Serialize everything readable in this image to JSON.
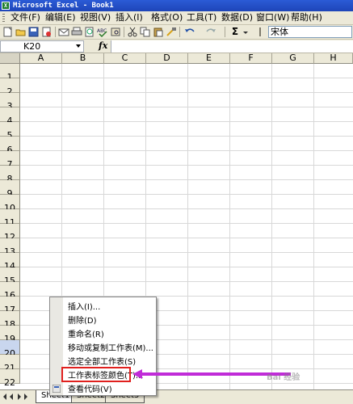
{
  "window": {
    "title": "Microsoft Excel - Book1",
    "app_icon": "excel-icon"
  },
  "menubar": {
    "items": [
      {
        "label": "文件(F)"
      },
      {
        "label": "编辑(E)"
      },
      {
        "label": "视图(V)"
      },
      {
        "label": "插入(I)"
      },
      {
        "label": "格式(O)"
      },
      {
        "label": "工具(T)"
      },
      {
        "label": "数据(D)"
      },
      {
        "label": "窗口(W)"
      },
      {
        "label": "帮助(H)"
      }
    ]
  },
  "toolbar": {
    "font_name": "宋体",
    "sum_symbol": "Σ",
    "icons": [
      "new-icon",
      "open-icon",
      "save-icon",
      "permission-icon",
      "email-icon",
      "print-icon",
      "print-preview-icon",
      "spelling-icon",
      "research-icon",
      "cut-icon",
      "copy-icon",
      "paste-icon",
      "format-painter-icon",
      "undo-icon",
      "redo-icon",
      "autosum-icon"
    ]
  },
  "formula_bar": {
    "name_box": "K20",
    "fx_label": "fx",
    "formula": ""
  },
  "grid": {
    "columns": [
      "A",
      "B",
      "C",
      "D",
      "E",
      "F",
      "G",
      "H"
    ],
    "rows": [
      "1",
      "2",
      "3",
      "4",
      "5",
      "6",
      "7",
      "8",
      "9",
      "10",
      "11",
      "12",
      "13",
      "14",
      "15",
      "16",
      "17",
      "18",
      "19",
      "20",
      "21",
      "22"
    ],
    "selected_row": "20"
  },
  "sheet_tabs": {
    "tabs": [
      {
        "label": "Sheet1"
      },
      {
        "label": "Sheet2"
      },
      {
        "label": "Sheet3"
      }
    ],
    "active_index": 0
  },
  "context_menu": {
    "items": [
      {
        "label": "插入(I)..."
      },
      {
        "label": "删除(D)"
      },
      {
        "label": "重命名(R)"
      },
      {
        "label": "移动或复制工作表(M)..."
      },
      {
        "label": "选定全部工作表(S)"
      },
      {
        "label": "工作表标签颜色(T)..."
      },
      {
        "label": "查看代码(V)"
      }
    ],
    "highlighted_index": 5,
    "highlight_color": "#e0201e",
    "arrow_color": "#c02bd8"
  },
  "watermark": {
    "text": "Bai 经验"
  }
}
